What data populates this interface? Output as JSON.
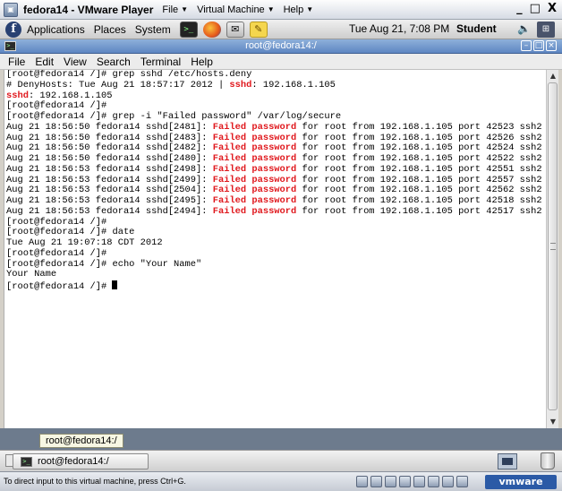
{
  "vmware": {
    "title": "fedora14 - VMware Player",
    "menus": [
      "File",
      "Virtual Machine",
      "Help"
    ],
    "window_controls": [
      "_",
      "□",
      "X"
    ],
    "status_text": "To direct input to this virtual machine, press Ctrl+G.",
    "brand": "vmware"
  },
  "gnome_panel": {
    "menus": [
      "Applications",
      "Places",
      "System"
    ],
    "clock": "Tue Aug 21,  7:08 PM",
    "user": "Student"
  },
  "terminal": {
    "title": "root@fedora14:/",
    "menus": [
      "File",
      "Edit",
      "View",
      "Search",
      "Terminal",
      "Help"
    ],
    "lines": [
      [
        {
          "t": "[root@fedora14 /]# grep sshd /etc/hosts.deny"
        }
      ],
      [
        {
          "t": "# DenyHosts: Tue Aug 21 18:57:17 2012 | "
        },
        {
          "t": "sshd",
          "c": "red"
        },
        {
          "t": ": 192.168.1.105"
        }
      ],
      [
        {
          "t": "sshd",
          "c": "red"
        },
        {
          "t": ": 192.168.1.105"
        }
      ],
      [
        {
          "t": "[root@fedora14 /]#"
        }
      ],
      [
        {
          "t": "[root@fedora14 /]# grep -i \"Failed password\" /var/log/secure"
        }
      ],
      [
        {
          "t": "Aug 21 18:56:50 fedora14 sshd[2481]: "
        },
        {
          "t": "Failed password",
          "c": "red"
        },
        {
          "t": " for root from 192.168.1.105 port 42523 ssh2"
        }
      ],
      [
        {
          "t": "Aug 21 18:56:50 fedora14 sshd[2483]: "
        },
        {
          "t": "Failed password",
          "c": "red"
        },
        {
          "t": " for root from 192.168.1.105 port 42526 ssh2"
        }
      ],
      [
        {
          "t": "Aug 21 18:56:50 fedora14 sshd[2482]: "
        },
        {
          "t": "Failed password",
          "c": "red"
        },
        {
          "t": " for root from 192.168.1.105 port 42524 ssh2"
        }
      ],
      [
        {
          "t": "Aug 21 18:56:50 fedora14 sshd[2480]: "
        },
        {
          "t": "Failed password",
          "c": "red"
        },
        {
          "t": " for root from 192.168.1.105 port 42522 ssh2"
        }
      ],
      [
        {
          "t": "Aug 21 18:56:53 fedora14 sshd[2498]: "
        },
        {
          "t": "Failed password",
          "c": "red"
        },
        {
          "t": " for root from 192.168.1.105 port 42551 ssh2"
        }
      ],
      [
        {
          "t": "Aug 21 18:56:53 fedora14 sshd[2499]: "
        },
        {
          "t": "Failed password",
          "c": "red"
        },
        {
          "t": " for root from 192.168.1.105 port 42557 ssh2"
        }
      ],
      [
        {
          "t": "Aug 21 18:56:53 fedora14 sshd[2504]: "
        },
        {
          "t": "Failed password",
          "c": "red"
        },
        {
          "t": " for root from 192.168.1.105 port 42562 ssh2"
        }
      ],
      [
        {
          "t": "Aug 21 18:56:53 fedora14 sshd[2495]: "
        },
        {
          "t": "Failed password",
          "c": "red"
        },
        {
          "t": " for root from 192.168.1.105 port 42518 ssh2"
        }
      ],
      [
        {
          "t": "Aug 21 18:56:53 fedora14 sshd[2494]: "
        },
        {
          "t": "Failed password",
          "c": "red"
        },
        {
          "t": " for root from 192.168.1.105 port 42517 ssh2"
        }
      ],
      [
        {
          "t": "[root@fedora14 /]#"
        }
      ],
      [
        {
          "t": "[root@fedora14 /]# date"
        }
      ],
      [
        {
          "t": "Tue Aug 21 19:07:18 CDT 2012"
        }
      ],
      [
        {
          "t": "[root@fedora14 /]#"
        }
      ],
      [
        {
          "t": "[root@fedora14 /]# echo \"Your Name\""
        }
      ],
      [
        {
          "t": "Your Name"
        }
      ],
      [
        {
          "t": "[root@fedora14 /]# "
        },
        {
          "t": "",
          "c": "cursor"
        }
      ]
    ]
  },
  "tooltip": "root@fedora14:/",
  "taskbar": {
    "window_label": "root@fedora14:/"
  },
  "colors": {
    "highlight_red": "#e0191e",
    "title_blue": "#5e86c2",
    "vmware_blue": "#2b5aa6"
  },
  "icons": {
    "launcher_terminal": "terminal-icon",
    "launcher_browser": "firefox-icon",
    "launcher_mail": "mail-icon",
    "launcher_editor": "text-editor-icon"
  }
}
